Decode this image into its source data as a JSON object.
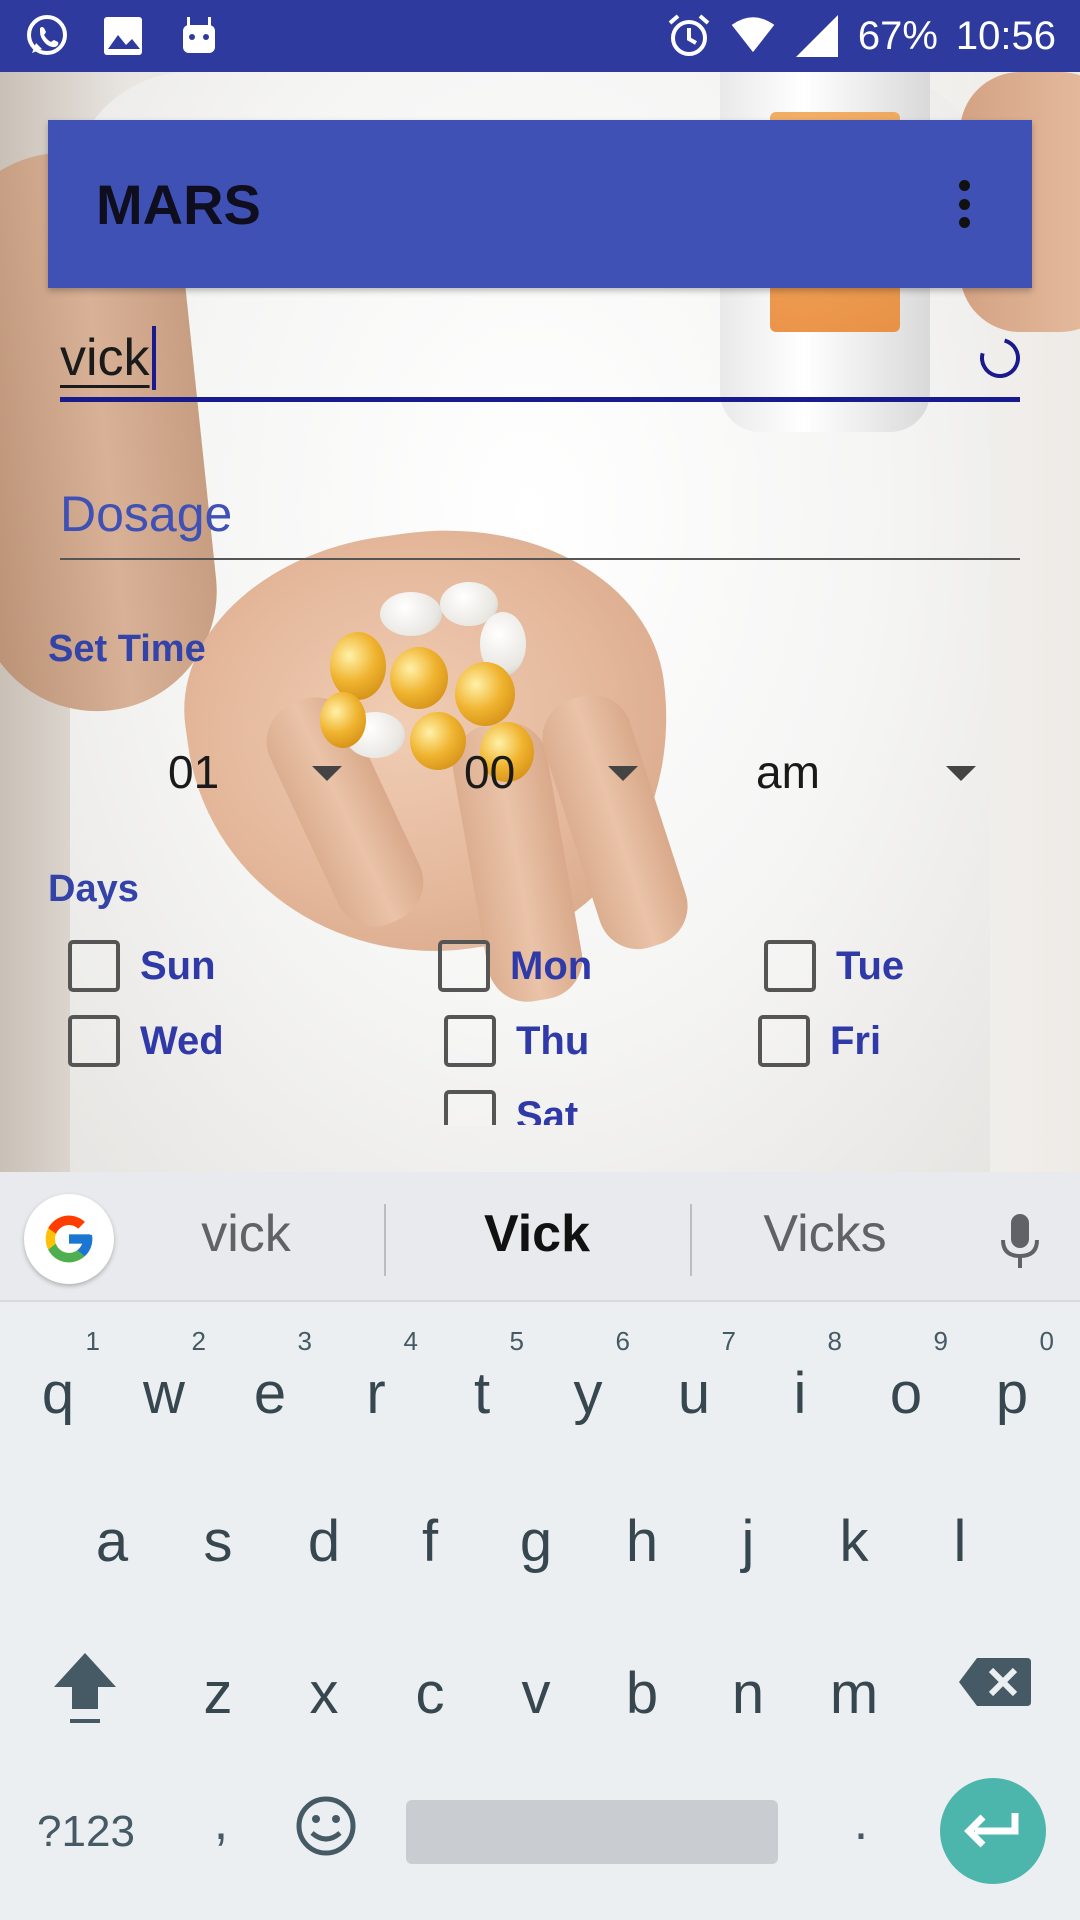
{
  "status_bar": {
    "battery": "67%",
    "time": "10:56",
    "icons": [
      "whatsapp-icon",
      "image-icon",
      "android-icon",
      "alarm-icon",
      "wifi-icon",
      "signal-icon"
    ]
  },
  "app_bar": {
    "title": "MARS",
    "menu_icon": "overflow-menu-icon"
  },
  "form": {
    "medicine_value": "vick",
    "dosage_placeholder": "Dosage",
    "set_time_label": "Set Time",
    "time": {
      "hour": "01",
      "minute": "00",
      "period": "am"
    },
    "days_label": "Days",
    "days": [
      "Sun",
      "Mon",
      "Tue",
      "Wed",
      "Thu",
      "Fri",
      "Sat"
    ]
  },
  "keyboard": {
    "suggestions": [
      "vick",
      "Vick",
      "Vicks"
    ],
    "row1": [
      {
        "key": "q",
        "hint": "1"
      },
      {
        "key": "w",
        "hint": "2"
      },
      {
        "key": "e",
        "hint": "3"
      },
      {
        "key": "r",
        "hint": "4"
      },
      {
        "key": "t",
        "hint": "5"
      },
      {
        "key": "y",
        "hint": "6"
      },
      {
        "key": "u",
        "hint": "7"
      },
      {
        "key": "i",
        "hint": "8"
      },
      {
        "key": "o",
        "hint": "9"
      },
      {
        "key": "p",
        "hint": "0"
      }
    ],
    "row2": [
      "a",
      "s",
      "d",
      "f",
      "g",
      "h",
      "j",
      "k",
      "l"
    ],
    "row3": [
      "z",
      "x",
      "c",
      "v",
      "b",
      "n",
      "m"
    ],
    "symbols_label": "?123",
    "comma": ",",
    "period": ".",
    "accent_color": "#4db6ac"
  },
  "colors": {
    "status_bar": "#2f3a9e",
    "app_bar": "#3f51b5",
    "label": "#3443a8"
  }
}
